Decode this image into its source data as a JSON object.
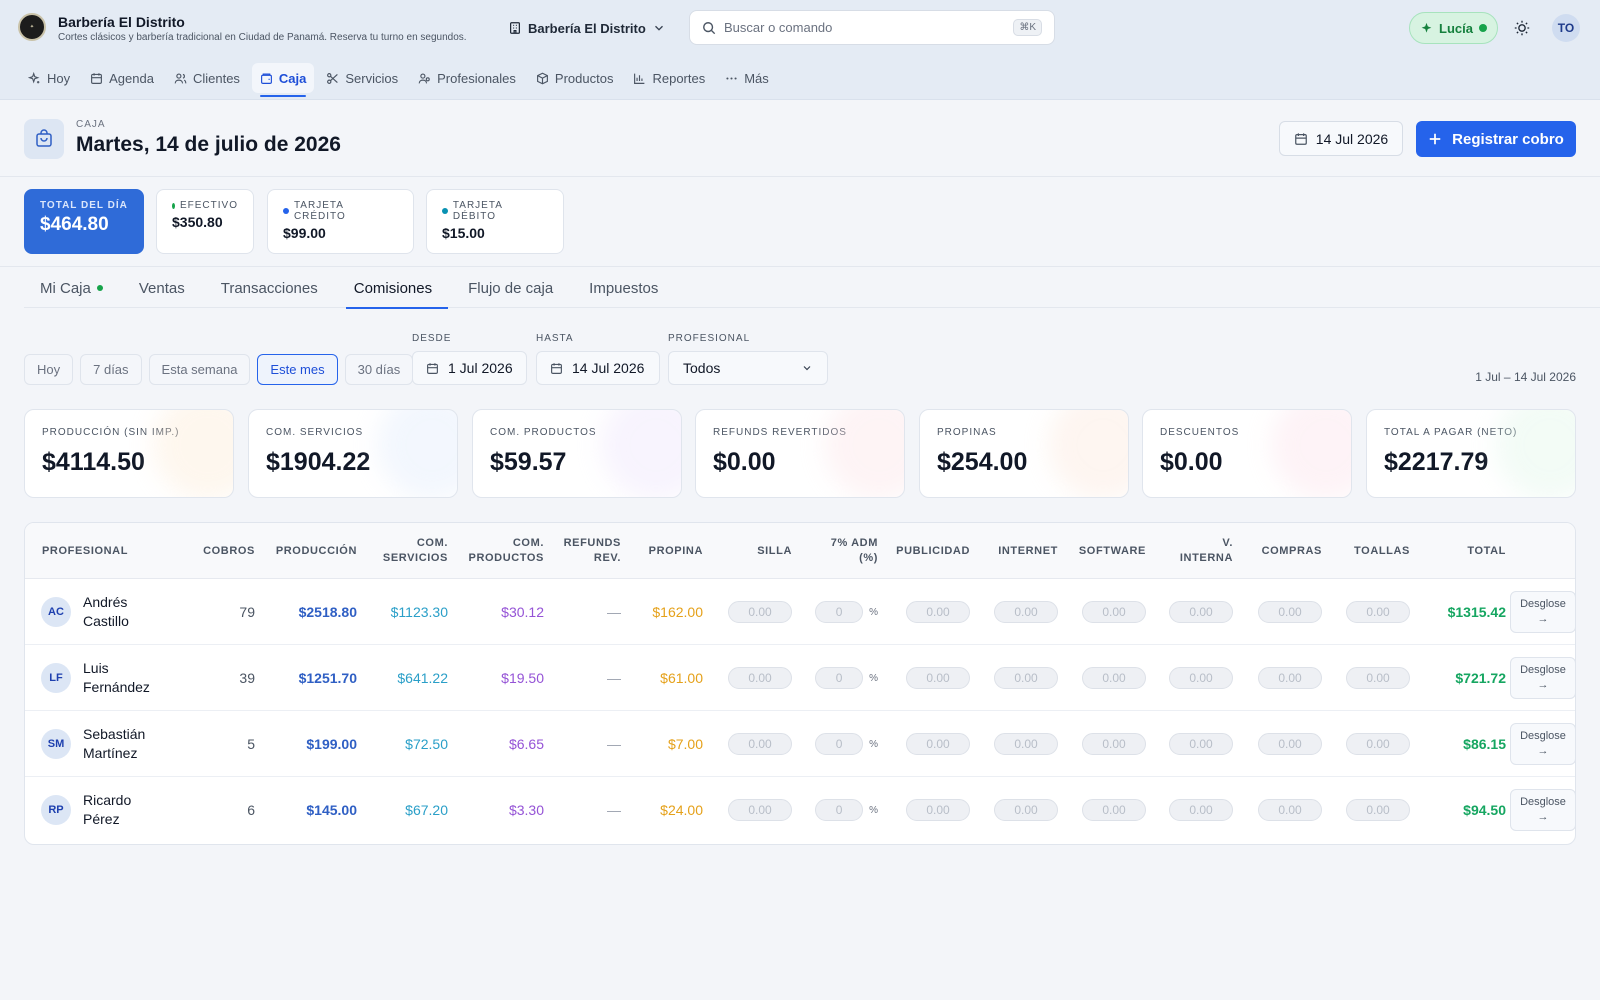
{
  "brand": {
    "name": "Barbería El Distrito",
    "subtitle": "Cortes clásicos y barbería tradicional en Ciudad de Panamá. Reserva tu turno en segundos.",
    "venue": "Barbería El Distrito"
  },
  "search": {
    "placeholder": "Buscar o comando",
    "shortcut": "⌘K"
  },
  "assistant": {
    "label": "Lucía"
  },
  "user": {
    "initials": "TO"
  },
  "nav": [
    {
      "label": "Hoy",
      "icon": "sparkle-icon"
    },
    {
      "label": "Agenda",
      "icon": "calendar-icon"
    },
    {
      "label": "Clientes",
      "icon": "users-icon"
    },
    {
      "label": "Caja",
      "icon": "wallet-icon"
    },
    {
      "label": "Servicios",
      "icon": "scissors-icon"
    },
    {
      "label": "Profesionales",
      "icon": "user-group-icon"
    },
    {
      "label": "Productos",
      "icon": "box-icon"
    },
    {
      "label": "Reportes",
      "icon": "bar-chart-icon"
    },
    {
      "label": "Más",
      "icon": "more-icon"
    }
  ],
  "page": {
    "label": "CAJA",
    "title": "Martes, 14 de julio de 2026",
    "date": "14 Jul 2026",
    "primary_action": "Registrar cobro"
  },
  "summary": {
    "total_label": "TOTAL DEL DÍA",
    "total_value": "$464.80",
    "cash_label": "EFECTIVO",
    "cash_value": "$350.80",
    "credit_label": "TARJETA CRÉDITO",
    "credit_value": "$99.00",
    "debit_label": "TARJETA DÉBITO",
    "debit_value": "$15.00",
    "colors": {
      "cash": "#16a34a",
      "credit": "#2563eb",
      "debit": "#0891b2"
    }
  },
  "tabs": [
    "Mi Caja",
    "Ventas",
    "Transacciones",
    "Comisiones",
    "Flujo de caja",
    "Impuestos"
  ],
  "filters": {
    "chips": [
      "Hoy",
      "7 días",
      "Esta semana",
      "Este mes",
      "30 días"
    ],
    "desde_label": "DESDE",
    "desde": "1 Jul 2026",
    "hasta_label": "HASTA",
    "hasta": "14 Jul 2026",
    "profesional_label": "PROFESIONAL",
    "profesional": "Todos",
    "range": "1 Jul – 14 Jul 2026"
  },
  "metrics": [
    {
      "label": "PRODUCCIÓN (SIN IMP.)",
      "value": "$4114.50"
    },
    {
      "label": "COM. SERVICIOS",
      "value": "$1904.22"
    },
    {
      "label": "COM. PRODUCTOS",
      "value": "$59.57"
    },
    {
      "label": "REFUNDS REVERTIDOS",
      "value": "$0.00"
    },
    {
      "label": "PROPINAS",
      "value": "$254.00"
    },
    {
      "label": "DESCUENTOS",
      "value": "$0.00"
    },
    {
      "label": "TOTAL A PAGAR (NETO)",
      "value": "$2217.79"
    }
  ],
  "table": {
    "headers": {
      "profesional": "PROFESIONAL",
      "cobros": "COBROS",
      "produccion": "PRODUCCIÓN",
      "com_serv_1": "COM.",
      "com_serv_2": "SERVICIOS",
      "com_prod_1": "COM.",
      "com_prod_2": "PRODUCTOS",
      "refunds_1": "REFUNDS",
      "refunds_2": "REV.",
      "propina": "PROPINA",
      "silla": "SILLA",
      "adm_1": "7% ADM",
      "adm_2": "(%)",
      "publicidad": "PUBLICIDAD",
      "internet": "INTERNET",
      "software": "SOFTWARE",
      "vinterna_1": "V.",
      "vinterna_2": "INTERNA",
      "compras": "COMPRAS",
      "toallas": "TOALLAS",
      "total": "TOTAL"
    },
    "placeholder_amount": "0.00",
    "placeholder_pct": "0",
    "pct_symbol": "%",
    "action_1": "Desglose",
    "action_2": "→",
    "refund_empty": "—",
    "rows": [
      {
        "initials": "AC",
        "first": "Andrés",
        "last": "Castillo",
        "cobros": "79",
        "produccion": "$2518.80",
        "com_serv": "$1123.30",
        "com_prod": "$30.12",
        "propina": "$162.00",
        "total": "$1315.42"
      },
      {
        "initials": "LF",
        "first": "Luis",
        "last": "Fernández",
        "cobros": "39",
        "produccion": "$1251.70",
        "com_serv": "$641.22",
        "com_prod": "$19.50",
        "propina": "$61.00",
        "total": "$721.72"
      },
      {
        "initials": "SM",
        "first": "Sebastián",
        "last": "Martínez",
        "cobros": "5",
        "produccion": "$199.00",
        "com_serv": "$72.50",
        "com_prod": "$6.65",
        "propina": "$7.00",
        "total": "$86.15"
      },
      {
        "initials": "RP",
        "first": "Ricardo",
        "last": "Pérez",
        "cobros": "6",
        "produccion": "$145.00",
        "com_serv": "$67.20",
        "com_prod": "$3.30",
        "propina": "$24.00",
        "total": "$94.50"
      }
    ]
  }
}
